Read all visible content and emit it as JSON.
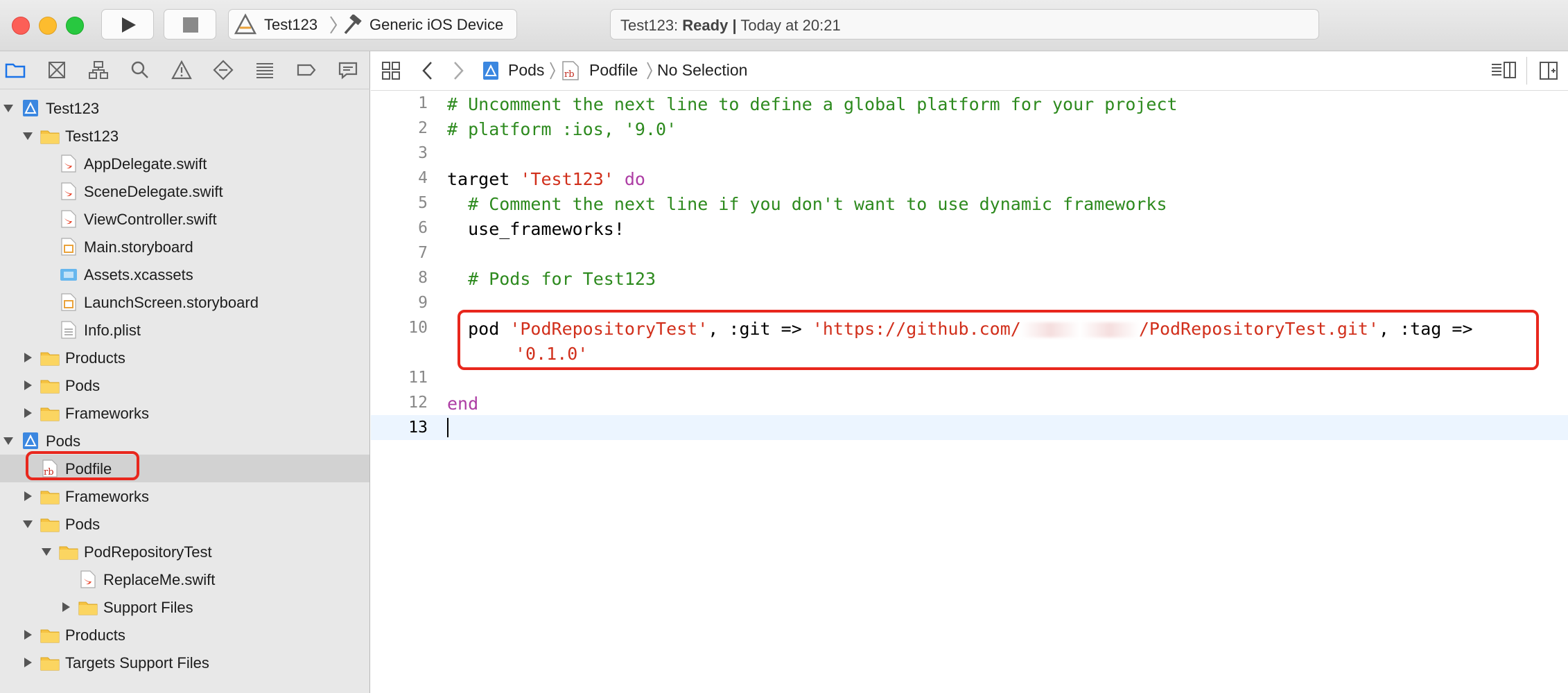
{
  "toolbar": {
    "scheme_target": "Test123",
    "scheme_device": "Generic iOS Device",
    "status_project": "Test123:",
    "status_state": "Ready",
    "status_sep": "|",
    "status_time": "Today at 20:21"
  },
  "navigator": {
    "items": [
      {
        "label": "Test123"
      },
      {
        "label": "Test123"
      },
      {
        "label": "AppDelegate.swift"
      },
      {
        "label": "SceneDelegate.swift"
      },
      {
        "label": "ViewController.swift"
      },
      {
        "label": "Main.storyboard"
      },
      {
        "label": "Assets.xcassets"
      },
      {
        "label": "LaunchScreen.storyboard"
      },
      {
        "label": "Info.plist"
      },
      {
        "label": "Products"
      },
      {
        "label": "Pods"
      },
      {
        "label": "Frameworks"
      },
      {
        "label": "Pods"
      },
      {
        "label": "Podfile"
      },
      {
        "label": "Frameworks"
      },
      {
        "label": "Pods"
      },
      {
        "label": "PodRepositoryTest"
      },
      {
        "label": "ReplaceMe.swift"
      },
      {
        "label": "Support Files"
      },
      {
        "label": "Products"
      },
      {
        "label": "Targets Support Files"
      }
    ]
  },
  "jumpbar": {
    "crumb1": "Pods",
    "crumb2": "Podfile",
    "crumb3": "No Selection"
  },
  "editor": {
    "line_numbers": [
      "1",
      "2",
      "3",
      "4",
      "5",
      "6",
      "7",
      "8",
      "9",
      "10",
      "11",
      "12",
      "13"
    ],
    "l1": "# Uncomment the next line to define a global platform for your project",
    "l2": "# platform :ios, '9.0'",
    "l4_a": "target ",
    "l4_b": "'Test123'",
    "l4_c": " do",
    "l5": "  # Comment the next line if you don't want to use dynamic frameworks",
    "l6": "  use_frameworks!",
    "l8": "  # Pods for Test123",
    "l10_a": "  pod ",
    "l10_b": "'PodRepositoryTest'",
    "l10_c": ", :git => ",
    "l10_d": "'https://github.com/",
    "l10_e": "/PodRepositoryTest.git'",
    "l10_f": ", :tag =>",
    "l10_g": "'0.1.0'",
    "l12": "end"
  },
  "colors": {
    "comment": "#2d8a1e",
    "string": "#d12f1b",
    "keyword": "#ad3da4",
    "highlight": "#e8271d"
  }
}
